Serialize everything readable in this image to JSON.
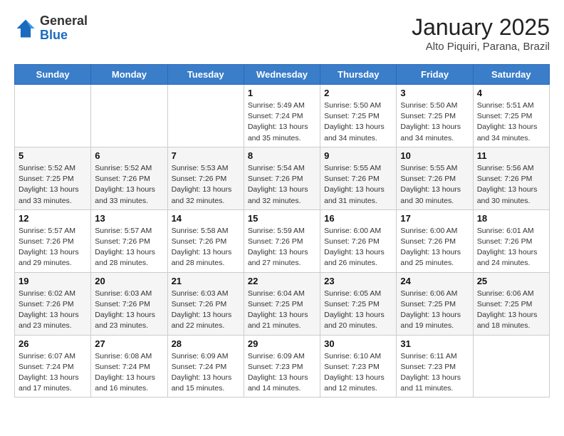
{
  "header": {
    "logo_general": "General",
    "logo_blue": "Blue",
    "title": "January 2025",
    "subtitle": "Alto Piquiri, Parana, Brazil"
  },
  "weekdays": [
    "Sunday",
    "Monday",
    "Tuesday",
    "Wednesday",
    "Thursday",
    "Friday",
    "Saturday"
  ],
  "weeks": [
    [
      {
        "day": "",
        "info": ""
      },
      {
        "day": "",
        "info": ""
      },
      {
        "day": "",
        "info": ""
      },
      {
        "day": "1",
        "info": "Sunrise: 5:49 AM\nSunset: 7:24 PM\nDaylight: 13 hours\nand 35 minutes."
      },
      {
        "day": "2",
        "info": "Sunrise: 5:50 AM\nSunset: 7:25 PM\nDaylight: 13 hours\nand 34 minutes."
      },
      {
        "day": "3",
        "info": "Sunrise: 5:50 AM\nSunset: 7:25 PM\nDaylight: 13 hours\nand 34 minutes."
      },
      {
        "day": "4",
        "info": "Sunrise: 5:51 AM\nSunset: 7:25 PM\nDaylight: 13 hours\nand 34 minutes."
      }
    ],
    [
      {
        "day": "5",
        "info": "Sunrise: 5:52 AM\nSunset: 7:25 PM\nDaylight: 13 hours\nand 33 minutes."
      },
      {
        "day": "6",
        "info": "Sunrise: 5:52 AM\nSunset: 7:26 PM\nDaylight: 13 hours\nand 33 minutes."
      },
      {
        "day": "7",
        "info": "Sunrise: 5:53 AM\nSunset: 7:26 PM\nDaylight: 13 hours\nand 32 minutes."
      },
      {
        "day": "8",
        "info": "Sunrise: 5:54 AM\nSunset: 7:26 PM\nDaylight: 13 hours\nand 32 minutes."
      },
      {
        "day": "9",
        "info": "Sunrise: 5:55 AM\nSunset: 7:26 PM\nDaylight: 13 hours\nand 31 minutes."
      },
      {
        "day": "10",
        "info": "Sunrise: 5:55 AM\nSunset: 7:26 PM\nDaylight: 13 hours\nand 30 minutes."
      },
      {
        "day": "11",
        "info": "Sunrise: 5:56 AM\nSunset: 7:26 PM\nDaylight: 13 hours\nand 30 minutes."
      }
    ],
    [
      {
        "day": "12",
        "info": "Sunrise: 5:57 AM\nSunset: 7:26 PM\nDaylight: 13 hours\nand 29 minutes."
      },
      {
        "day": "13",
        "info": "Sunrise: 5:57 AM\nSunset: 7:26 PM\nDaylight: 13 hours\nand 28 minutes."
      },
      {
        "day": "14",
        "info": "Sunrise: 5:58 AM\nSunset: 7:26 PM\nDaylight: 13 hours\nand 28 minutes."
      },
      {
        "day": "15",
        "info": "Sunrise: 5:59 AM\nSunset: 7:26 PM\nDaylight: 13 hours\nand 27 minutes."
      },
      {
        "day": "16",
        "info": "Sunrise: 6:00 AM\nSunset: 7:26 PM\nDaylight: 13 hours\nand 26 minutes."
      },
      {
        "day": "17",
        "info": "Sunrise: 6:00 AM\nSunset: 7:26 PM\nDaylight: 13 hours\nand 25 minutes."
      },
      {
        "day": "18",
        "info": "Sunrise: 6:01 AM\nSunset: 7:26 PM\nDaylight: 13 hours\nand 24 minutes."
      }
    ],
    [
      {
        "day": "19",
        "info": "Sunrise: 6:02 AM\nSunset: 7:26 PM\nDaylight: 13 hours\nand 23 minutes."
      },
      {
        "day": "20",
        "info": "Sunrise: 6:03 AM\nSunset: 7:26 PM\nDaylight: 13 hours\nand 23 minutes."
      },
      {
        "day": "21",
        "info": "Sunrise: 6:03 AM\nSunset: 7:26 PM\nDaylight: 13 hours\nand 22 minutes."
      },
      {
        "day": "22",
        "info": "Sunrise: 6:04 AM\nSunset: 7:25 PM\nDaylight: 13 hours\nand 21 minutes."
      },
      {
        "day": "23",
        "info": "Sunrise: 6:05 AM\nSunset: 7:25 PM\nDaylight: 13 hours\nand 20 minutes."
      },
      {
        "day": "24",
        "info": "Sunrise: 6:06 AM\nSunset: 7:25 PM\nDaylight: 13 hours\nand 19 minutes."
      },
      {
        "day": "25",
        "info": "Sunrise: 6:06 AM\nSunset: 7:25 PM\nDaylight: 13 hours\nand 18 minutes."
      }
    ],
    [
      {
        "day": "26",
        "info": "Sunrise: 6:07 AM\nSunset: 7:24 PM\nDaylight: 13 hours\nand 17 minutes."
      },
      {
        "day": "27",
        "info": "Sunrise: 6:08 AM\nSunset: 7:24 PM\nDaylight: 13 hours\nand 16 minutes."
      },
      {
        "day": "28",
        "info": "Sunrise: 6:09 AM\nSunset: 7:24 PM\nDaylight: 13 hours\nand 15 minutes."
      },
      {
        "day": "29",
        "info": "Sunrise: 6:09 AM\nSunset: 7:23 PM\nDaylight: 13 hours\nand 14 minutes."
      },
      {
        "day": "30",
        "info": "Sunrise: 6:10 AM\nSunset: 7:23 PM\nDaylight: 13 hours\nand 12 minutes."
      },
      {
        "day": "31",
        "info": "Sunrise: 6:11 AM\nSunset: 7:23 PM\nDaylight: 13 hours\nand 11 minutes."
      },
      {
        "day": "",
        "info": ""
      }
    ]
  ]
}
